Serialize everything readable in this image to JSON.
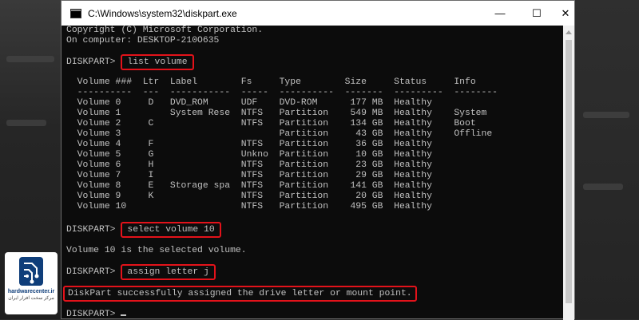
{
  "window": {
    "title": "C:\\Windows\\system32\\diskpart.exe",
    "minimize_glyph": "—",
    "maximize_glyph": "☐",
    "close_glyph": "✕"
  },
  "watermark": {
    "brand": "hardwarecenter.ir",
    "tagline": "مرکز سخت افزار ایران"
  },
  "console": {
    "copyright": "Copyright (C) Microsoft Corporation.",
    "computer": "On computer: DESKTOP-210O635",
    "prompt": "DISKPART> ",
    "cmd_list": "list volume",
    "header": "  Volume ###  Ltr  Label        Fs     Type        Size     Status     Info",
    "divider": "  ----------  ---  -----------  -----  ----------  -------  ---------  --------",
    "volumes": [
      "  Volume 0     D   DVD_ROM      UDF    DVD-ROM      177 MB  Healthy",
      "  Volume 1         System Rese  NTFS   Partition    549 MB  Healthy    System",
      "  Volume 2     C                NTFS   Partition    134 GB  Healthy    Boot",
      "  Volume 3                             Partition     43 GB  Healthy    Offline",
      "  Volume 4     F                NTFS   Partition     36 GB  Healthy",
      "  Volume 5     G                Unkno  Partition     10 GB  Healthy",
      "  Volume 6     H                NTFS   Partition     23 GB  Healthy",
      "  Volume 7     I                NTFS   Partition     29 GB  Healthy",
      "  Volume 8     E   Storage spa  NTFS   Partition    141 GB  Healthy",
      "  Volume 9     K                NTFS   Partition     20 GB  Healthy",
      "  Volume 10                     NTFS   Partition    495 GB  Healthy"
    ],
    "cmd_select": "select volume 10",
    "select_result": "Volume 10 is the selected volume.",
    "cmd_assign": "assign letter j",
    "assign_result": "DiskPart successfully assigned the drive letter or mount point."
  }
}
